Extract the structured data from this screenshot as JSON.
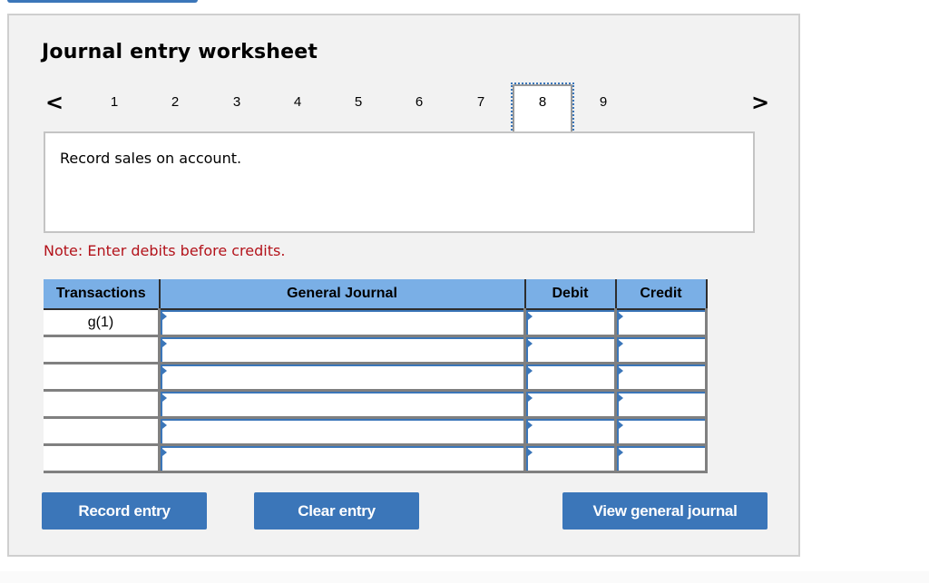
{
  "worksheet": {
    "title": "Journal entry worksheet",
    "pager": {
      "prev_icon": "<",
      "next_icon": ">",
      "pages": [
        "1",
        "2",
        "3",
        "4",
        "5",
        "6",
        "7",
        "8",
        "9"
      ],
      "active_page": "8"
    },
    "prompt": "Record sales on account.",
    "note": "Note: Enter debits before credits.",
    "table": {
      "headers": [
        "Transactions",
        "General Journal",
        "Debit",
        "Credit"
      ],
      "rows": [
        {
          "transaction": "g(1)",
          "account": "",
          "debit": "",
          "credit": ""
        },
        {
          "transaction": "",
          "account": "",
          "debit": "",
          "credit": ""
        },
        {
          "transaction": "",
          "account": "",
          "debit": "",
          "credit": ""
        },
        {
          "transaction": "",
          "account": "",
          "debit": "",
          "credit": ""
        },
        {
          "transaction": "",
          "account": "",
          "debit": "",
          "credit": ""
        },
        {
          "transaction": "",
          "account": "",
          "debit": "",
          "credit": ""
        }
      ]
    },
    "buttons": {
      "record": "Record entry",
      "clear": "Clear entry",
      "view": "View general journal"
    }
  },
  "colors": {
    "accent": "#3b76b9",
    "header_bg": "#7aafe6",
    "note": "#b3131b",
    "panel_bg": "#f2f2f2"
  }
}
